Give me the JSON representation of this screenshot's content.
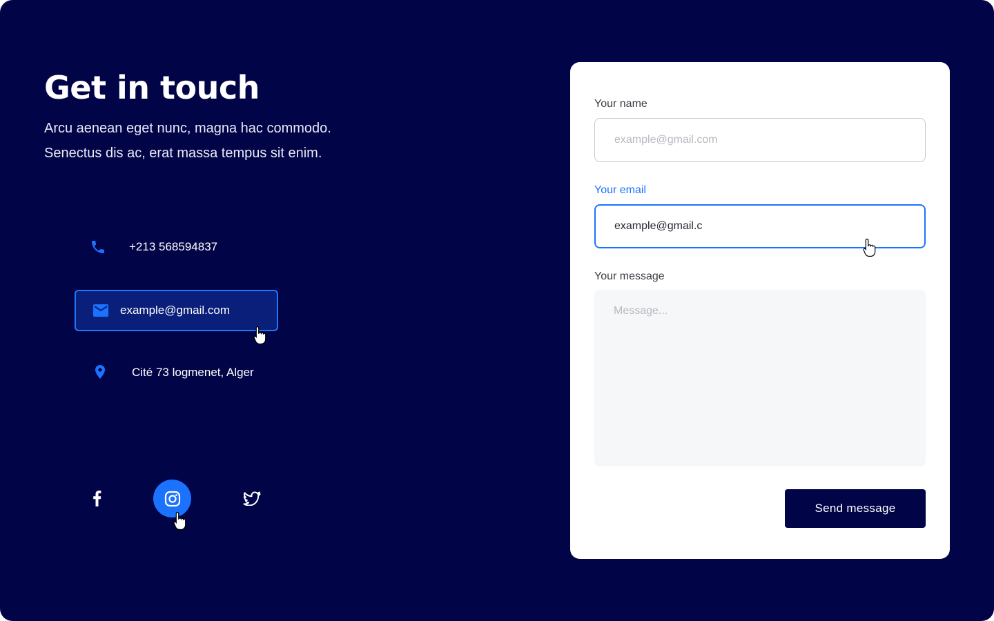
{
  "heading": {
    "title": "Get in touch",
    "subtitle_line1": "Arcu aenean eget nunc, magna hac commodo.",
    "subtitle_line2": "Senectus dis ac, erat massa tempus sit enim."
  },
  "contacts": {
    "phone": {
      "icon": "phone-icon",
      "text": "+213 568594837"
    },
    "email": {
      "icon": "mail-icon",
      "text": "example@gmail.com"
    },
    "address": {
      "icon": "location-pin-icon",
      "text": "Cité 73 logmenet, Alger"
    }
  },
  "social": {
    "items": [
      {
        "icon": "facebook-icon"
      },
      {
        "icon": "instagram-icon"
      },
      {
        "icon": "twitter-icon"
      }
    ]
  },
  "form": {
    "name_label": "Your name",
    "name_placeholder": "example@gmail.com",
    "email_label": "Your email",
    "email_value": "example@gmail.c",
    "message_label": "Your message",
    "message_placeholder": "Message...",
    "send_label": "Send message"
  },
  "colors": {
    "background": "#020448",
    "accent": "#1a72ff",
    "card": "#ffffff",
    "email_highlight": "#0a1f7a"
  }
}
